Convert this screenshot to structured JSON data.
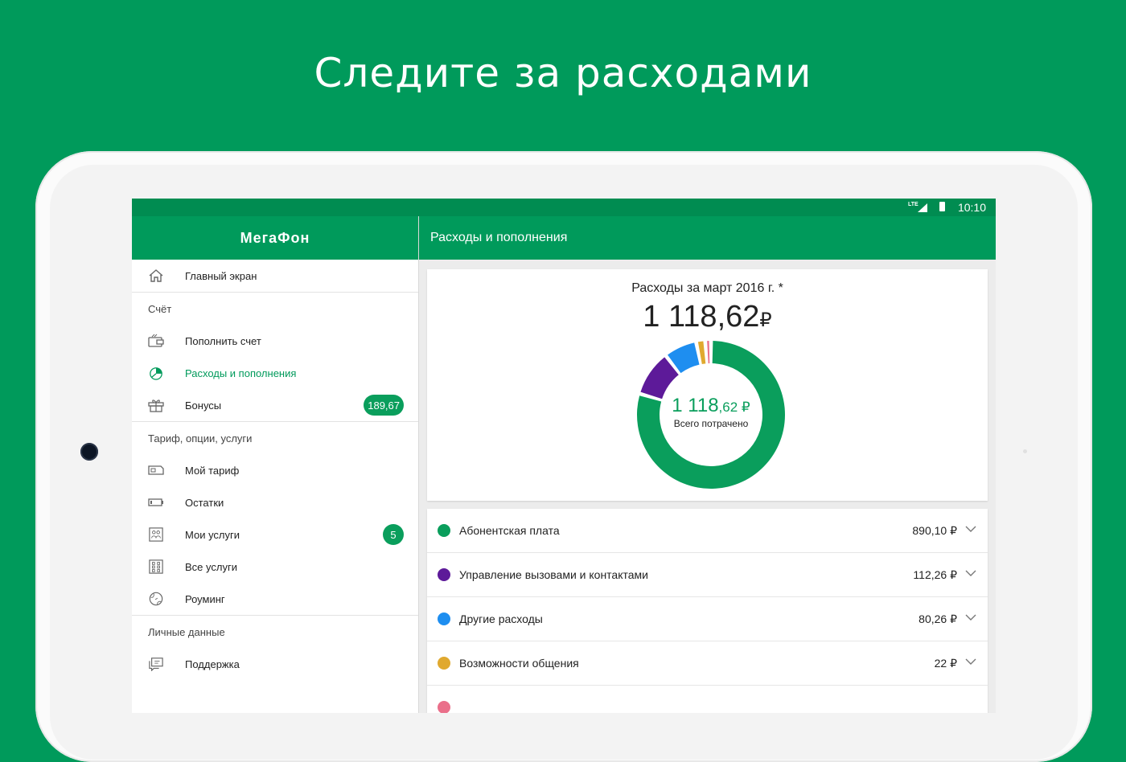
{
  "headline": "Следите за расходами",
  "status": {
    "time": "10:10",
    "network": "LTE"
  },
  "drawer": {
    "logo": "МегаФон",
    "home": {
      "label": "Главный экран",
      "icon": "home-icon"
    },
    "sections": [
      {
        "title": "Счёт"
      },
      {
        "title": "Тариф, опции, услуги"
      },
      {
        "title": "Личные данные"
      }
    ],
    "items": {
      "topup": {
        "label": "Пополнить счет",
        "icon": "wallet-icon"
      },
      "expenses": {
        "label": "Расходы и пополнения",
        "icon": "pie-chart-icon",
        "active": true
      },
      "bonuses": {
        "label": "Бонусы",
        "icon": "gift-icon",
        "badge": "189,67"
      },
      "tariff": {
        "label": "Мой тариф",
        "icon": "sim-card-icon"
      },
      "remains": {
        "label": "Остатки",
        "icon": "battery-icon"
      },
      "my_services": {
        "label": "Мои услуги",
        "icon": "services-icon",
        "badge": "5"
      },
      "all_services": {
        "label": "Все услуги",
        "icon": "grid-icon"
      },
      "roaming": {
        "label": "Роуминг",
        "icon": "globe-icon"
      },
      "support": {
        "label": "Поддержка",
        "icon": "chat-icon"
      }
    }
  },
  "main": {
    "title": "Расходы и пополнения",
    "summary": {
      "title": "Расходы за март 2016 г. *",
      "total_main": "1 118,62",
      "currency": "₽",
      "center_big": "1 118",
      "center_small": ",62 ₽",
      "center_label": "Всего потрачено"
    }
  },
  "chart_data": {
    "type": "pie",
    "title": "Расходы за март 2016 г. *",
    "total": 1118.62,
    "series": [
      {
        "name": "Абонентская плата",
        "value": 890.1,
        "amount_text": "890,10 ₽",
        "color": "#0a9e5c"
      },
      {
        "name": "Управление вызовами и контактами",
        "value": 112.26,
        "amount_text": "112,26 ₽",
        "color": "#5d1a99"
      },
      {
        "name": "Другие расходы",
        "value": 80.26,
        "amount_text": "80,26 ₽",
        "color": "#1e8ef0"
      },
      {
        "name": "Возможности общения",
        "value": 22,
        "amount_text": "22 ₽",
        "color": "#e0a92f"
      },
      {
        "name": "",
        "value": 14,
        "color": "#ea6f8a"
      }
    ]
  },
  "colors": {
    "brand": "#009a5b",
    "status_bar": "#008c51",
    "accent": "#0a9e5c"
  }
}
